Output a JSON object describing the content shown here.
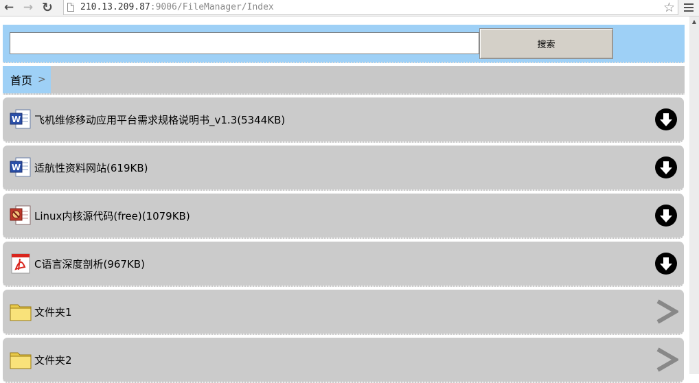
{
  "browser": {
    "url_host": "210.13.209.87",
    "url_path": ":9006/FileManager/Index"
  },
  "search": {
    "input_value": "",
    "button_label": "搜索"
  },
  "breadcrumb": {
    "home_label": "首页"
  },
  "items": [
    {
      "label": "飞机维修移动应用平台需求规格说明书_v1.3(5344KB)",
      "icon": "word-document-icon",
      "action": "download-icon"
    },
    {
      "label": "适航性资料网站(619KB)",
      "icon": "word-document-icon",
      "action": "download-icon"
    },
    {
      "label": "Linux内核源代码(free)(1079KB)",
      "icon": "archive-file-icon",
      "action": "download-icon"
    },
    {
      "label": "C语言深度剖析(967KB)",
      "icon": "pdf-file-icon",
      "action": "download-icon"
    },
    {
      "label": "文件夹1",
      "icon": "folder-icon",
      "action": "chevron-right-icon"
    },
    {
      "label": "文件夹2",
      "icon": "folder-icon",
      "action": "chevron-right-icon"
    }
  ],
  "colors": {
    "accent_blue": "#9ed0f6",
    "item_gray": "#cbcbcb"
  }
}
